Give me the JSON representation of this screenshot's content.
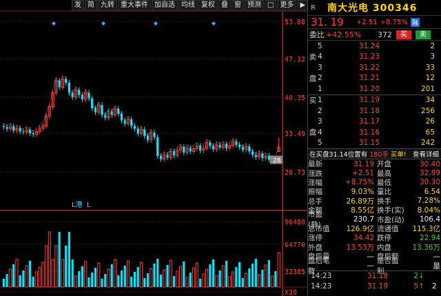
{
  "toolbar": {
    "buttons": [
      "发",
      "简",
      "九转",
      "重大事件",
      "加自选",
      "均线",
      "复权",
      "叠",
      "窗",
      "预测",
      "□",
      "更多",
      "▶"
    ]
  },
  "axis": {
    "price_ticks": [
      "53.88",
      "47.12",
      "40.35",
      "33.49",
      "26.73"
    ],
    "volume_ticks": [
      "96480",
      "64770",
      "32385",
      "X10"
    ],
    "last_label": "28."
  },
  "markers": {
    "l_label": "L",
    "l2_label": "L港"
  },
  "panel": {
    "title_icon": "R",
    "title": "南大光电  300346",
    "price": "31. 19",
    "change": "+2.51",
    "change_pct": "+8.75%",
    "tag": "融",
    "weibi_label": "委比",
    "weibi_pct": "+42.55%",
    "weibi_diff": "372",
    "buy_btn": "买",
    "sell_btn": "卖",
    "asks": [
      {
        "side": "",
        "lvl": "5",
        "price": "31.24",
        "vol": "2"
      },
      {
        "side": "卖",
        "lvl": "4",
        "price": "31.23",
        "vol": "3"
      },
      {
        "side": "",
        "lvl": "3",
        "price": "31.22",
        "vol": "33"
      },
      {
        "side": "盘",
        "lvl": "2",
        "price": "31.21",
        "vol": "12"
      },
      {
        "side": "",
        "lvl": "1",
        "price": "31.20",
        "vol": "201"
      }
    ],
    "bids": [
      {
        "side": "买",
        "lvl": "1",
        "price": "31.19",
        "vol": "34"
      },
      {
        "side": "",
        "lvl": "2",
        "price": "31.18",
        "vol": "256"
      },
      {
        "side": "",
        "lvl": "3",
        "price": "31.17",
        "vol": "26"
      },
      {
        "side": "盘",
        "lvl": "4",
        "price": "31.16",
        "vol": "65"
      },
      {
        "side": "",
        "lvl": "5",
        "price": "31.15",
        "vol": "242"
      }
    ],
    "notice_text": "在买盘31.14位置有",
    "notice_vol": "180手",
    "notice_action": "买单!",
    "notice_link": "查看详细",
    "stats": [
      {
        "k": "最新",
        "v": "31.19",
        "vc": "red",
        "k2": "开盘",
        "v2": "30.40",
        "v2c": "red"
      },
      {
        "k": "涨跌",
        "v": "+2.51",
        "vc": "red",
        "k2": "最高",
        "v2": "32.89",
        "v2c": "red"
      },
      {
        "k": "涨幅",
        "v": "+8.75%",
        "vc": "red",
        "k2": "最低",
        "v2": "30.30",
        "v2c": "red"
      },
      {
        "k": "振幅",
        "v": "9.03%",
        "vc": "yel",
        "k2": "量比",
        "v2": "6.54",
        "v2c": "yel"
      },
      {
        "k": "总手",
        "v": "26.89万",
        "vc": "yel",
        "k2": "换手",
        "v2": "7.28%",
        "v2c": "yel"
      },
      {
        "k": "金额",
        "v": "8.55亿",
        "vc": "yel",
        "k2": "换手(实)",
        "v2": "8.04%",
        "v2c": "yel"
      },
      {
        "k": "市盈(静)",
        "v": "230.7",
        "vc": "wht",
        "k2": "市盈(动)",
        "v2": "106.4",
        "v2c": "wht"
      },
      {
        "k": "总市值",
        "v": "126.9亿",
        "vc": "yel",
        "k2": "流通值",
        "v2": "115.3亿",
        "v2c": "yel"
      },
      {
        "k": "涨停",
        "v": "34.42",
        "vc": "red",
        "k2": "跌停",
        "v2": "22.94",
        "v2c": "green"
      },
      {
        "k": "外盘",
        "v": "13.53万",
        "vc": "red",
        "k2": "内盘",
        "v2": "13.36万",
        "v2c": "green"
      },
      {
        "k": "盘后量",
        "v": "—",
        "vc": "wht",
        "k2": "盘后额",
        "v2": "—",
        "v2c": "wht"
      },
      {
        "k": "盘后笔数",
        "v": "—",
        "vc": "wht",
        "k2": "是否盈利",
        "v2": "是",
        "v2c": "wht"
      }
    ],
    "ticks": [
      {
        "time": "14:23",
        "price": "31.18",
        "vol": "2",
        "arrow": "↓",
        "pc": "red",
        "vc": "green"
      },
      {
        "time": "14:23",
        "price": "31.19",
        "vol": "5",
        "arrow": "↑",
        "pc": "red",
        "vc": "red",
        "extra": "2"
      }
    ]
  },
  "colors": {
    "up": "#ff3b3b",
    "down": "#00e5ff",
    "bg": "#000000",
    "axis": "#ff3b3b"
  }
}
